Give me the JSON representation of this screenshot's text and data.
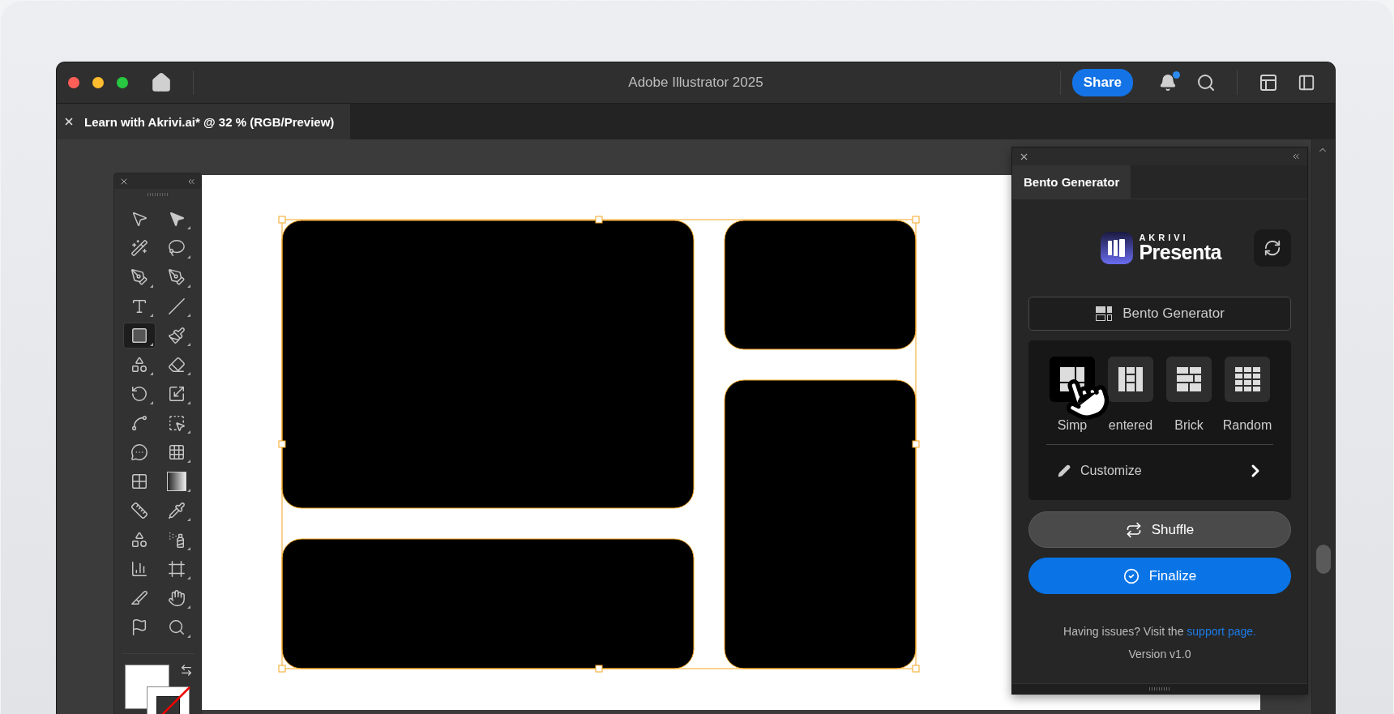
{
  "window": {
    "title": "Adobe Illustrator 2025",
    "share": "Share",
    "notifications_unread": true
  },
  "document_tab": {
    "title": "Learn with Akrivi.ai* @ 32 % (RGB/Preview)"
  },
  "toolbox": {
    "tools": [
      {
        "selected": false
      },
      {
        "selected": false
      },
      {
        "selected": false
      },
      {
        "selected": false
      },
      {
        "selected": false
      },
      {
        "selected": false
      },
      {
        "selected": false
      },
      {
        "selected": false
      },
      {
        "selected": true
      },
      {
        "selected": false
      },
      {
        "selected": false
      },
      {
        "selected": false
      },
      {
        "selected": false
      },
      {
        "selected": false
      },
      {
        "selected": false
      },
      {
        "selected": false
      },
      {
        "selected": false
      },
      {
        "selected": false
      },
      {
        "selected": false
      },
      {
        "selected": false
      },
      {
        "selected": false
      },
      {
        "selected": false
      },
      {
        "selected": false
      },
      {
        "selected": false
      },
      {
        "selected": false
      },
      {
        "selected": false
      },
      {
        "selected": false
      },
      {
        "selected": false
      },
      {
        "selected": false
      },
      {
        "selected": false
      }
    ]
  },
  "artboard": {
    "selection_active": true
  },
  "panel": {
    "tab": "Bento Generator",
    "brand": {
      "overline": "AKRIVI",
      "name": "Presenta"
    },
    "mode_button": "Bento Generator",
    "layouts": [
      {
        "label": "Simp",
        "selected": true
      },
      {
        "label": "entered",
        "selected": false
      },
      {
        "label": "Brick",
        "selected": false
      },
      {
        "label": "Random",
        "selected": false
      }
    ],
    "customize": "Customize",
    "shuffle": "Shuffle",
    "finalize": "Finalize",
    "help": {
      "text": "Having issues? Visit the",
      "link": "support page."
    },
    "version": "Version v1.0"
  }
}
